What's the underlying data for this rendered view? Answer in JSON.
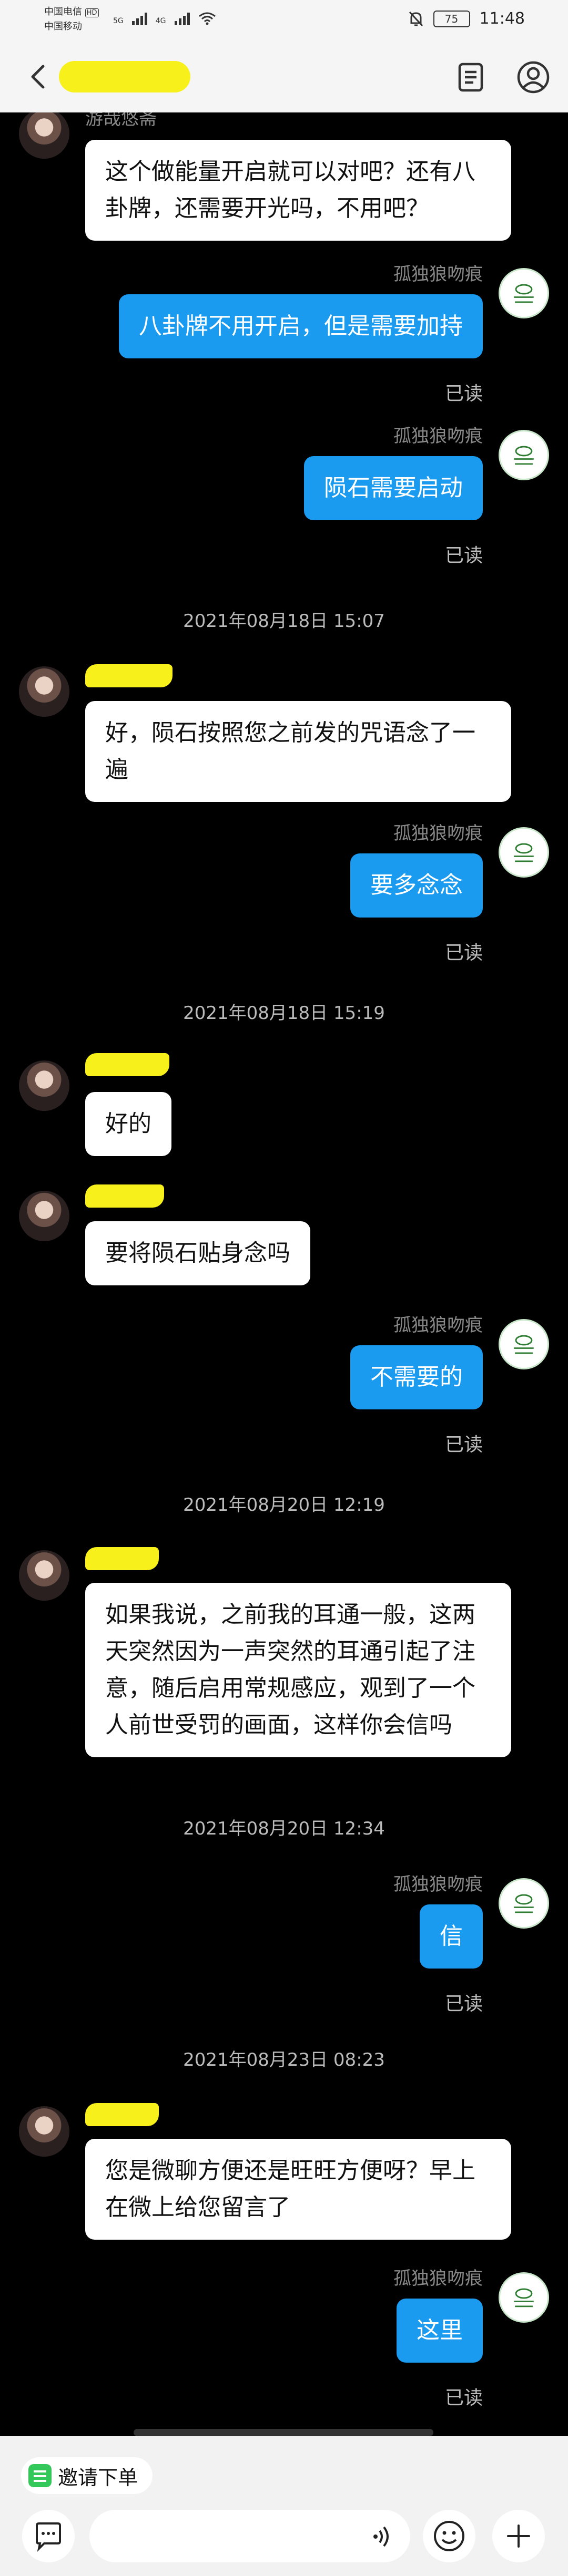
{
  "status_bar": {
    "carrier1": "中国电信",
    "carrier1_badge": "HD",
    "carrier2": "中国移动",
    "net1": "5G",
    "net2": "4G",
    "battery": "75",
    "time": "11:48"
  },
  "header": {
    "contact_name": ""
  },
  "messages": [
    {
      "type": "in",
      "nick": "游哉悠斋",
      "text": "这个做能量开启就可以对吧？还有八卦牌，还需要开光吗，不用吧？"
    },
    {
      "type": "out",
      "nick": "孤独狼吻痕",
      "text": "八卦牌不用开启，但是需要加持",
      "status": "已读"
    },
    {
      "type": "out",
      "nick": "孤独狼吻痕",
      "text": "陨石需要启动",
      "status": "已读"
    },
    {
      "type": "time",
      "text": "2021年08月18日 15:07"
    },
    {
      "type": "in",
      "nick": "",
      "text": "好，陨石按照您之前发的咒语念了一遍"
    },
    {
      "type": "out",
      "nick": "孤独狼吻痕",
      "text": "要多念念",
      "status": "已读"
    },
    {
      "type": "time",
      "text": "2021年08月18日 15:19"
    },
    {
      "type": "in",
      "nick": "",
      "text": "好的"
    },
    {
      "type": "in",
      "nick": "",
      "text": "要将陨石贴身念吗"
    },
    {
      "type": "out",
      "nick": "孤独狼吻痕",
      "text": "不需要的",
      "status": "已读"
    },
    {
      "type": "time",
      "text": "2021年08月20日 12:19"
    },
    {
      "type": "in",
      "nick": "",
      "text": "如果我说，之前我的耳通一般，这两天突然因为一声突然的耳通引起了注意，随后启用常规感应，观到了一个人前世受罚的画面，这样你会信吗"
    },
    {
      "type": "time",
      "text": "2021年08月20日 12:34"
    },
    {
      "type": "out",
      "nick": "孤独狼吻痕",
      "text": "信",
      "status": "已读"
    },
    {
      "type": "time",
      "text": "2021年08月23日 08:23"
    },
    {
      "type": "in",
      "nick": "",
      "text": "您是微聊方便还是旺旺方便呀？早上在微上给您留言了"
    },
    {
      "type": "out",
      "nick": "孤独狼吻痕",
      "text": "这里",
      "status": "已读"
    }
  ],
  "bottom": {
    "invite_label": "邀请下单"
  }
}
